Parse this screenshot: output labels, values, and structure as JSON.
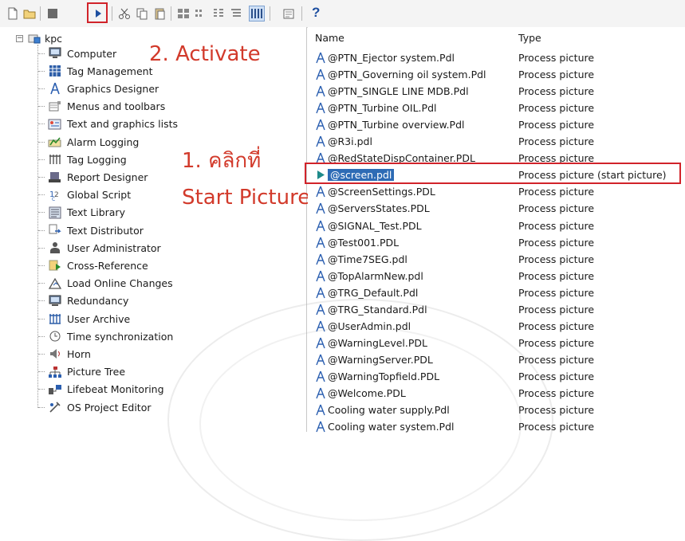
{
  "toolbar": {
    "help_label": "?",
    "buttons": [
      "new-icon",
      "open-icon",
      "stop-icon",
      "activate-icon",
      "cut-icon",
      "copy-icon",
      "paste-icon",
      "large-icons-icon",
      "small-icons-icon",
      "list-icon",
      "details-icon",
      "properties-icon",
      "help-icon"
    ]
  },
  "annotations": {
    "step2": "2. Activate",
    "step1_line1": "1. คลิกที่",
    "step1_line2": "Start Picture"
  },
  "tree": {
    "root": "kpc",
    "items": [
      {
        "label": "Computer",
        "icon": "computer-icon"
      },
      {
        "label": "Tag Management",
        "icon": "tag-management-icon"
      },
      {
        "label": "Graphics Designer",
        "icon": "graphics-designer-icon"
      },
      {
        "label": "Menus and toolbars",
        "icon": "menus-toolbars-icon"
      },
      {
        "label": "Text and graphics lists",
        "icon": "text-graphics-lists-icon"
      },
      {
        "label": "Alarm Logging",
        "icon": "alarm-logging-icon"
      },
      {
        "label": "Tag Logging",
        "icon": "tag-logging-icon"
      },
      {
        "label": "Report Designer",
        "icon": "report-designer-icon"
      },
      {
        "label": "Global Script",
        "icon": "global-script-icon"
      },
      {
        "label": "Text Library",
        "icon": "text-library-icon"
      },
      {
        "label": "Text Distributor",
        "icon": "text-distributor-icon"
      },
      {
        "label": "User Administrator",
        "icon": "user-administrator-icon"
      },
      {
        "label": "Cross-Reference",
        "icon": "cross-reference-icon"
      },
      {
        "label": "Load Online Changes",
        "icon": "load-online-changes-icon"
      },
      {
        "label": "Redundancy",
        "icon": "redundancy-icon"
      },
      {
        "label": "User Archive",
        "icon": "user-archive-icon"
      },
      {
        "label": "Time synchronization",
        "icon": "time-sync-icon"
      },
      {
        "label": "Horn",
        "icon": "horn-icon"
      },
      {
        "label": "Picture Tree",
        "icon": "picture-tree-icon"
      },
      {
        "label": "Lifebeat Monitoring",
        "icon": "lifebeat-icon"
      },
      {
        "label": "OS Project Editor",
        "icon": "os-project-editor-icon"
      }
    ]
  },
  "list": {
    "col_name": "Name",
    "col_type": "Type",
    "rows": [
      {
        "name": "@PTN_Ejector system.Pdl",
        "type": "Process picture"
      },
      {
        "name": "@PTN_Governing oil system.Pdl",
        "type": "Process picture"
      },
      {
        "name": "@PTN_SINGLE LINE MDB.Pdl",
        "type": "Process picture"
      },
      {
        "name": "@PTN_Turbine OIL.Pdl",
        "type": "Process picture"
      },
      {
        "name": "@PTN_Turbine overview.Pdl",
        "type": "Process picture"
      },
      {
        "name": "@R3i.pdl",
        "type": "Process picture"
      },
      {
        "name": "@RedStateDispContainer.PDL",
        "type": "Process picture"
      },
      {
        "name": "@screen.pdl",
        "type": "Process picture (start picture)"
      },
      {
        "name": "@ScreenSettings.PDL",
        "type": "Process picture"
      },
      {
        "name": "@ServersStates.PDL",
        "type": "Process picture"
      },
      {
        "name": "@SIGNAL_Test.PDL",
        "type": "Process picture"
      },
      {
        "name": "@Test001.PDL",
        "type": "Process picture"
      },
      {
        "name": "@Time7SEG.pdl",
        "type": "Process picture"
      },
      {
        "name": "@TopAlarmNew.pdl",
        "type": "Process picture"
      },
      {
        "name": "@TRG_Default.Pdl",
        "type": "Process picture"
      },
      {
        "name": "@TRG_Standard.Pdl",
        "type": "Process picture"
      },
      {
        "name": "@UserAdmin.pdl",
        "type": "Process picture"
      },
      {
        "name": "@WarningLevel.PDL",
        "type": "Process picture"
      },
      {
        "name": "@WarningServer.PDL",
        "type": "Process picture"
      },
      {
        "name": "@WarningTopfield.PDL",
        "type": "Process picture"
      },
      {
        "name": "@Welcome.PDL",
        "type": "Process picture"
      },
      {
        "name": "Cooling water supply.Pdl",
        "type": "Process picture"
      },
      {
        "name": "Cooling water system.Pdl",
        "type": "Process picture"
      }
    ]
  },
  "colors": {
    "annotation": "#d23a2b",
    "highlight_box": "#d1232a",
    "selection": "#2d6bb5",
    "graphics_icon": "#2b5fb0"
  }
}
